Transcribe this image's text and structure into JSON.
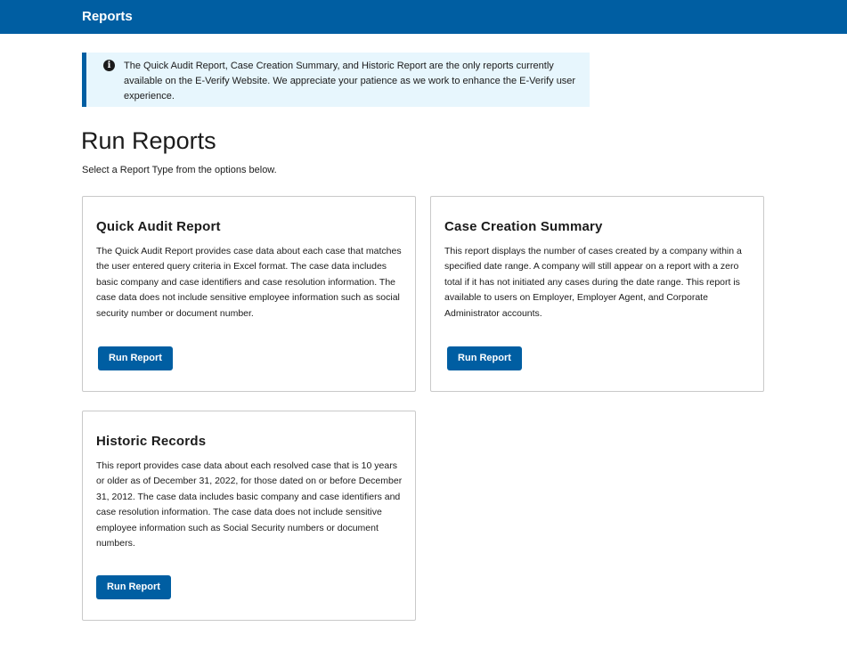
{
  "header": {
    "title": "Reports"
  },
  "alert": {
    "icon": "info-icon",
    "text": "The Quick Audit Report, Case Creation Summary, and Historic Report are the only reports currently available on the E-Verify Website. We appreciate your patience as we work to enhance the E-Verify user experience."
  },
  "page": {
    "title": "Run Reports",
    "subtitle": "Select a Report Type from the options below."
  },
  "cards": [
    {
      "title": "Quick Audit Report",
      "description": "The Quick Audit Report provides case data about each case that matches the user entered query criteria in Excel format. The case data includes basic company and case identifiers and case resolution information. The case data does not include sensitive employee information such as social security number or document number.",
      "button_label": "Run Report"
    },
    {
      "title": "Case Creation Summary",
      "description": "This report displays the number of cases created by a company within a specified date range. A company will still appear on a report with a zero total if it has not initiated any cases during the date range. This report is available to users on Employer, Employer Agent, and Corporate Administrator accounts.",
      "button_label": "Run Report"
    },
    {
      "title": "Historic Records",
      "description": "This report provides case data about each resolved case that is 10 years or older as of December 31, 2022, for those dated on or before December 31, 2012. The case data includes basic company and case identifiers and case resolution information. The case data does not include sensitive employee information such as Social Security numbers or document numbers.",
      "button_label": "Run Report"
    }
  ],
  "colors": {
    "brand": "#005ea2",
    "alert_bg": "#e7f6fd",
    "card_border": "#c9c9c9"
  }
}
